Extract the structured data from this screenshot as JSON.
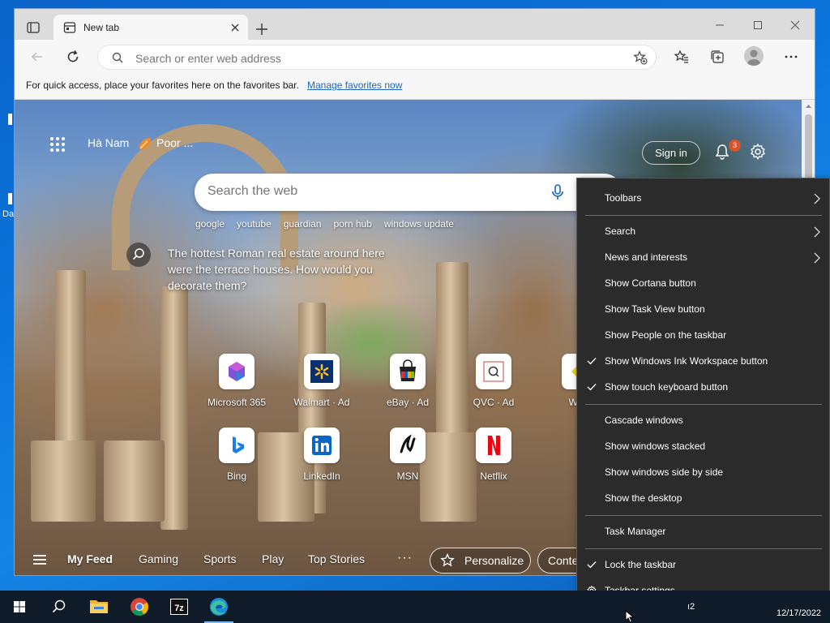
{
  "desktop": {
    "edge_label": "Da"
  },
  "browser": {
    "tab": {
      "title": "New tab",
      "icon": "new-tab-page-icon"
    },
    "address_bar": {
      "placeholder": "Search or enter web address"
    },
    "favorites_bar": {
      "text": "For quick access, place your favorites here on the favorites bar.",
      "link": "Manage favorites now"
    }
  },
  "newtab": {
    "location": "Hà Nam",
    "weather": "Poor ...",
    "signin": "Sign in",
    "notification_count": "3",
    "search": {
      "placeholder": "Search the web"
    },
    "trending": [
      "google",
      "youtube",
      "guardian",
      "porn hub",
      "windows update"
    ],
    "info_text": "The hottest Roman real estate around here were the terrace houses. How would you decorate them?",
    "tiles_row1": [
      {
        "label": "Microsoft 365",
        "icon": "microsoft-365-icon"
      },
      {
        "label": "Walmart · Ad",
        "icon": "walmart-icon"
      },
      {
        "label": "eBay · Ad",
        "icon": "ebay-icon"
      },
      {
        "label": "QVC · Ad",
        "icon": "qvc-icon"
      },
      {
        "label": "Wayf",
        "icon": "wayfair-icon"
      }
    ],
    "tiles_row2": [
      {
        "label": "Bing",
        "icon": "bing-icon"
      },
      {
        "label": "LinkedIn",
        "icon": "linkedin-icon"
      },
      {
        "label": "MSN",
        "icon": "msn-icon"
      },
      {
        "label": "Netflix",
        "icon": "netflix-icon"
      }
    ],
    "feed": {
      "items": [
        "My Feed",
        "Gaming",
        "Sports",
        "Play",
        "Top Stories"
      ],
      "more": "···",
      "personalize": "Personalize",
      "content_btn": "Conte"
    }
  },
  "context_menu": {
    "items": [
      {
        "label": "Toolbars",
        "submenu": true,
        "checked": false
      },
      {
        "label": "Search",
        "submenu": true,
        "checked": false
      },
      {
        "label": "News and interests",
        "submenu": true,
        "checked": false
      },
      {
        "label": "Show Cortana button",
        "submenu": false,
        "checked": false
      },
      {
        "label": "Show Task View button",
        "submenu": false,
        "checked": false
      },
      {
        "label": "Show People on the taskbar",
        "submenu": false,
        "checked": false
      },
      {
        "label": "Show Windows Ink Workspace button",
        "submenu": false,
        "checked": true
      },
      {
        "label": "Show touch keyboard button",
        "submenu": false,
        "checked": true
      },
      {
        "label": "Cascade windows",
        "submenu": false,
        "checked": false
      },
      {
        "label": "Show windows stacked",
        "submenu": false,
        "checked": false
      },
      {
        "label": "Show windows side by side",
        "submenu": false,
        "checked": false
      },
      {
        "label": "Show the desktop",
        "submenu": false,
        "checked": false
      },
      {
        "label": "Task Manager",
        "submenu": false,
        "checked": false
      },
      {
        "label": "Lock the taskbar",
        "submenu": false,
        "checked": true
      },
      {
        "label": "Taskbar settings",
        "submenu": false,
        "checked": false,
        "icon": "gear-icon"
      }
    ]
  },
  "taskbar": {
    "apps": [
      "start-icon",
      "search-icon",
      "file-explorer-icon",
      "chrome-icon",
      "7zip-icon",
      "edge-icon"
    ],
    "clock_date": "12/17/2022"
  },
  "colors": {
    "accent_link": "#1a66c4",
    "badge": "#d9532b",
    "menu_bg": "#2b2b2b",
    "taskbar_bg": "#101b2a"
  }
}
